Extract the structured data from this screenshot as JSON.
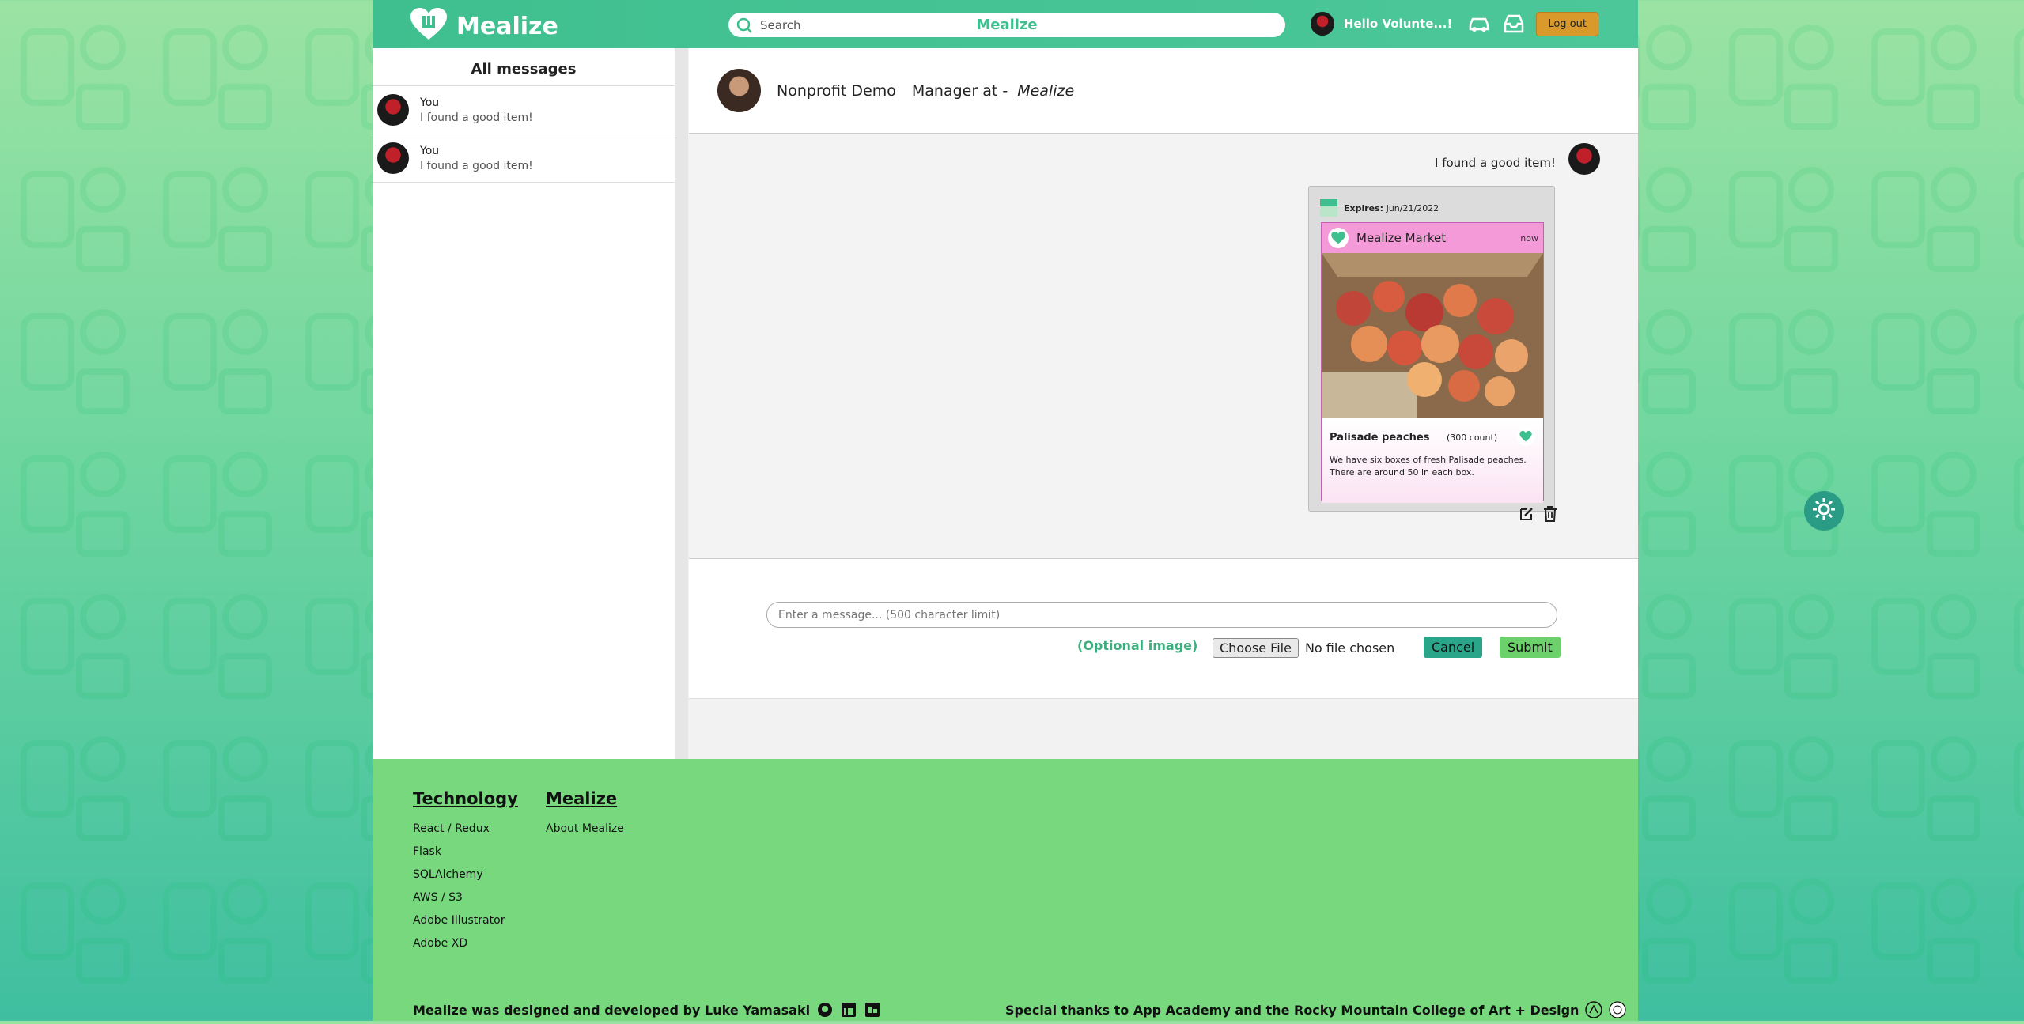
{
  "nav": {
    "brand": "Mealize",
    "search_placeholder": "Search",
    "search_brand": "Mealize",
    "greeting": "Hello Volunte...!",
    "logout": "Log out"
  },
  "sidebar": {
    "title": "All messages",
    "threads": [
      {
        "name": "You",
        "preview": "I found a good item!"
      },
      {
        "name": "You",
        "preview": "I found a good item!"
      }
    ]
  },
  "conversation": {
    "manager_name": "Nonprofit Demo",
    "manager_role": "Manager at -",
    "manager_org": "Mealize",
    "message_text": "I found a good item!",
    "card": {
      "expires_label": "Expires:",
      "expires_date": "Jun/21/2022",
      "market": "Mealize Market",
      "time": "now",
      "item_name": "Palisade peaches",
      "item_count": "(300 count)",
      "description": "We have six boxes of fresh Palisade peaches. There are around 50 in each box."
    }
  },
  "compose": {
    "placeholder": "Enter a message... (500 character limit)",
    "optional_label": "(Optional image)",
    "choose_file": "Choose File",
    "no_file": "No file chosen",
    "cancel": "Cancel",
    "submit": "Submit"
  },
  "footer": {
    "tech_heading": "Technology",
    "tech_items": [
      "React / Redux",
      "Flask",
      "SQLAlchemy",
      "AWS / S3",
      "Adobe Illustrator",
      "Adobe XD"
    ],
    "mealize_heading": "Mealize",
    "about": "About Mealize",
    "credit_left": "Mealize was designed and developed by Luke Yamasaki",
    "credit_right": "Special thanks to App Academy and the Rocky Mountain College of Art + Design"
  },
  "colors": {
    "brand_green": "#3fbf8f",
    "card_pink": "#f49ad8",
    "footer_green": "#77d87e",
    "logout_orange": "#d99a2b"
  }
}
